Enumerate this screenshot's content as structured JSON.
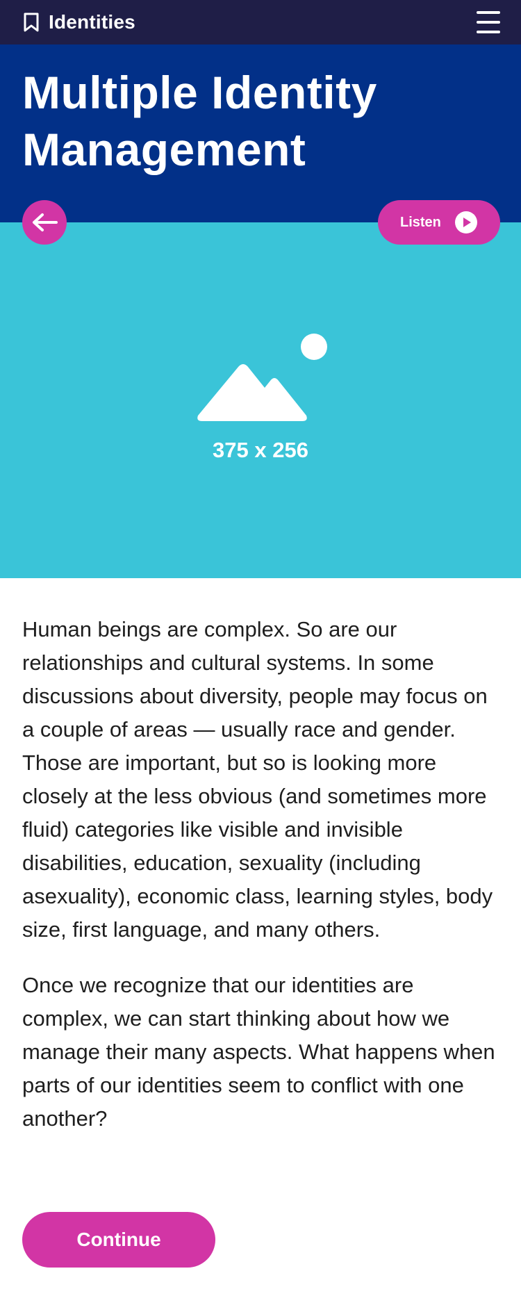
{
  "header": {
    "app_title": "Identities",
    "brand_icon": "bookmark-icon",
    "menu_icon": "hamburger-menu-icon"
  },
  "hero": {
    "title": "Multiple Identity Management",
    "background_color": "#023088",
    "back_icon": "arrow-left-icon",
    "listen_label": "Listen",
    "listen_icon": "play-icon",
    "image": {
      "placeholder_icon": "image-placeholder-icon",
      "placeholder_label": "375 x 256",
      "background_color": "#3ac4d8"
    }
  },
  "content": {
    "paragraphs": [
      "Human beings are complex. So are our relationships and cultural systems. In some discussions about diversity, people may focus on a couple of areas — usually race and gender. Those are important, but so is looking more closely at the less obvious (and sometimes more fluid) categories like visible and invisible disabilities, education, sexuality (including asexuality), economic class, learning styles, body size, first language, and many others.",
      "Once we recognize that our identities are complex, we can start thinking about how we manage their many aspects. What happens when parts of our identities seem to conflict with one another?"
    ]
  },
  "actions": {
    "continue_label": "Continue"
  },
  "colors": {
    "topbar": "#1f1e47",
    "accent": "#d235a5"
  }
}
